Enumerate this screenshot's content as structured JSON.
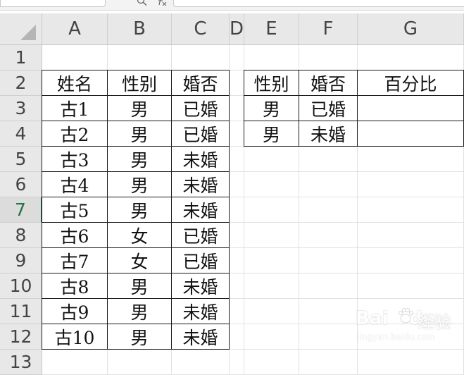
{
  "toolbar": {
    "namebox_value": "",
    "formula_value": ""
  },
  "columns": [
    "A",
    "B",
    "C",
    "D",
    "E",
    "F",
    "G"
  ],
  "rows": [
    "1",
    "2",
    "3",
    "4",
    "5",
    "6",
    "7",
    "8",
    "9",
    "10",
    "11",
    "12",
    "13"
  ],
  "active_row": "7",
  "table1": {
    "headers": [
      "姓名",
      "性别",
      "婚否"
    ],
    "rows": [
      [
        "古1",
        "男",
        "已婚"
      ],
      [
        "古2",
        "男",
        "已婚"
      ],
      [
        "古3",
        "男",
        "未婚"
      ],
      [
        "古4",
        "男",
        "未婚"
      ],
      [
        "古5",
        "男",
        "未婚"
      ],
      [
        "古6",
        "女",
        "已婚"
      ],
      [
        "古7",
        "女",
        "已婚"
      ],
      [
        "古8",
        "男",
        "未婚"
      ],
      [
        "古9",
        "男",
        "未婚"
      ],
      [
        "古10",
        "男",
        "未婚"
      ]
    ]
  },
  "table2": {
    "headers": [
      "性别",
      "婚否",
      "百分比"
    ],
    "rows": [
      [
        "男",
        "已婚",
        ""
      ],
      [
        "男",
        "未婚",
        ""
      ]
    ]
  },
  "watermark": {
    "logo": "Bai",
    "logo2": "du",
    "cn": "经验",
    "url": "jingyan.baidu.com"
  },
  "colors": {
    "accent": "#217346",
    "header_bg": "#e8e8e8",
    "grid": "#e1e1e1"
  }
}
